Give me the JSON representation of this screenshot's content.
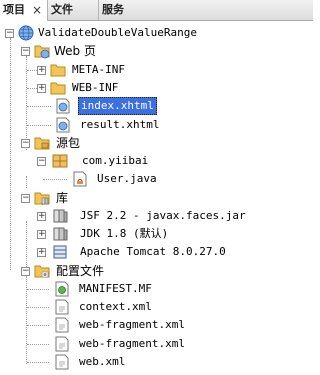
{
  "tabs": [
    {
      "label": "项目",
      "close": "×"
    },
    {
      "label": "文件"
    },
    {
      "label": "服务"
    }
  ],
  "tree": {
    "project": "ValidateDoubleValueRange",
    "web_pages": "Web 页",
    "meta_inf": "META-INF",
    "web_inf": "WEB-INF",
    "index_file": "index.xhtml",
    "result_file": "result.xhtml",
    "source_packages": "源包",
    "package_name": "com.yiibai",
    "user_java": "User.java",
    "libraries": "库",
    "lib_jsf": "JSF 2.2 - javax.faces.jar",
    "lib_jdk": "JDK 1.8 (默认)",
    "lib_tomcat": "Apache Tomcat 8.0.27.0",
    "config_files": "配置文件",
    "cfg_manifest": "MANIFEST.MF",
    "cfg_context": "context.xml",
    "cfg_fragment1": "web-fragment.xml",
    "cfg_fragment2": "web-fragment.xml",
    "cfg_web": "web.xml"
  },
  "colors": {
    "selection": "#3c6fe0",
    "folder": "#e8b84a",
    "globe": "#3b7bd1"
  }
}
